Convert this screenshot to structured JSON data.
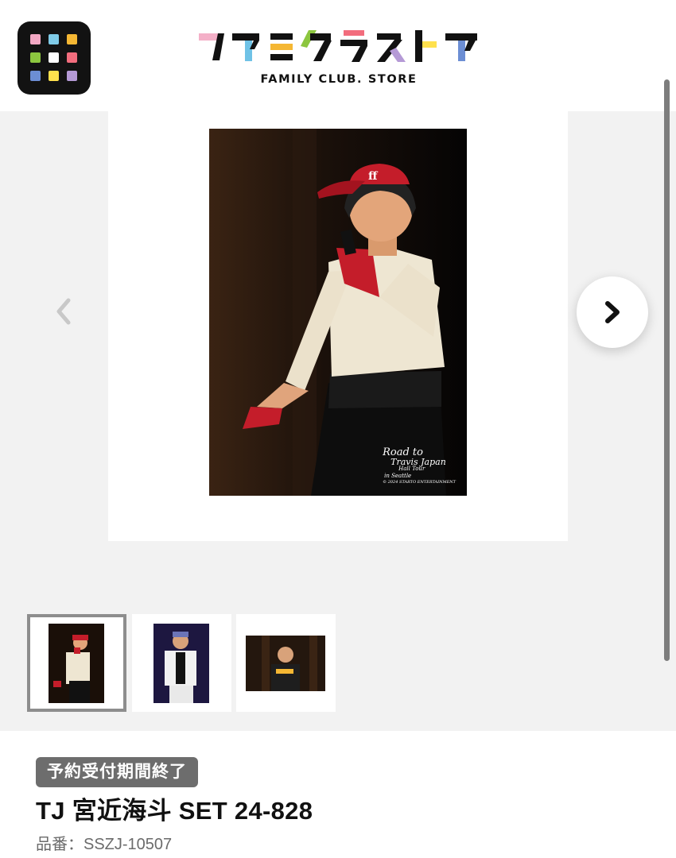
{
  "header": {
    "logo_text": "ファミクラストア",
    "logo_subtitle": "FAMILY CLUB. STORE",
    "menu_icon": "grid-menu-icon"
  },
  "gallery": {
    "main_image_watermark": [
      "Road to",
      "Travis Japan",
      "Hall Tour",
      "in Seattle",
      "© 2024 STARTO ENTERTAINMENT"
    ],
    "prev_icon": "chevron-left-icon",
    "next_icon": "chevron-right-icon",
    "thumbnails_count": 3,
    "active_thumbnail": 1
  },
  "product": {
    "status": "予約受付期間終了",
    "title": "TJ 宮近海斗 SET 24-828",
    "code": "品番：SSZJ-10507"
  },
  "colors": {
    "menu_bg": "#121212",
    "gallery_bg": "#f2f2f2",
    "badge_bg": "#6d6d6d",
    "grid": [
      "#f2a7c3",
      "#7fcbe8",
      "#f5b733",
      "#8cc63f",
      "#ffffff",
      "#f26d7d",
      "#6c8ed4",
      "#ffe14d",
      "#b59ad6"
    ]
  }
}
